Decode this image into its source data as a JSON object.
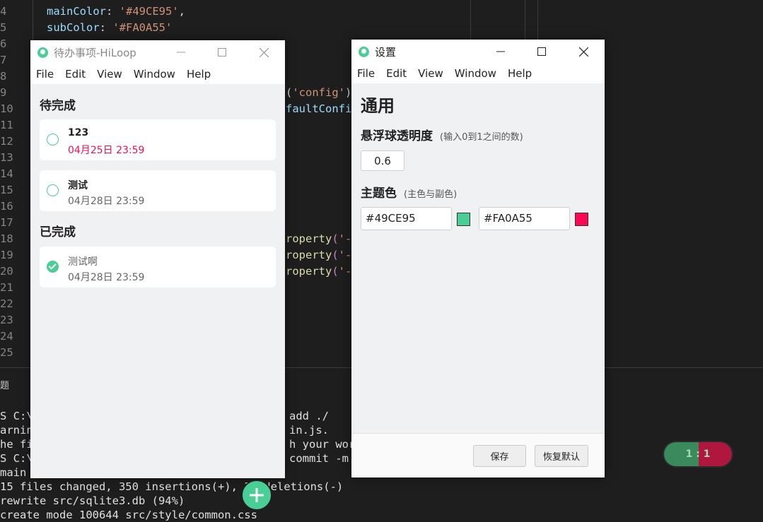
{
  "editor": {
    "lines": [
      {
        "num": "4",
        "parts": [
          [
            "kw",
            "mainColor"
          ],
          [
            "plain",
            ": "
          ],
          [
            "str",
            "'#49CE95'"
          ],
          [
            "plain",
            ","
          ]
        ]
      },
      {
        "num": "5",
        "parts": [
          [
            "kw",
            "subColor"
          ],
          [
            "plain",
            ": "
          ],
          [
            "str",
            "'#FA0A55'"
          ]
        ]
      },
      {
        "num": "6",
        "parts": []
      },
      {
        "num": "7",
        "parts": []
      },
      {
        "num": "8",
        "parts": []
      },
      {
        "num": "9",
        "parts": [
          [
            "plain",
            "("
          ],
          [
            "str",
            "'config'"
          ],
          [
            "plain",
            ")"
          ]
        ]
      },
      {
        "num": "10",
        "parts": [
          [
            "kw",
            "faultConfi"
          ]
        ]
      },
      {
        "num": "11",
        "parts": []
      },
      {
        "num": "12",
        "parts": []
      },
      {
        "num": "13",
        "parts": []
      },
      {
        "num": "14",
        "parts": []
      },
      {
        "num": "15",
        "parts": []
      },
      {
        "num": "16",
        "parts": []
      },
      {
        "num": "17",
        "parts": []
      },
      {
        "num": "18",
        "parts": [
          [
            "fn",
            "roperty"
          ],
          [
            "pn",
            "("
          ],
          [
            "str",
            "'-"
          ]
        ]
      },
      {
        "num": "19",
        "parts": [
          [
            "fn",
            "roperty"
          ],
          [
            "pn",
            "("
          ],
          [
            "str",
            "'-"
          ]
        ]
      },
      {
        "num": "20",
        "parts": [
          [
            "fn",
            "roperty"
          ],
          [
            "pn",
            "("
          ],
          [
            "str",
            "'-"
          ]
        ]
      },
      {
        "num": "21",
        "parts": []
      },
      {
        "num": "22",
        "parts": []
      },
      {
        "num": "23",
        "parts": []
      },
      {
        "num": "24",
        "parts": []
      },
      {
        "num": "25",
        "parts": []
      }
    ]
  },
  "terminal": {
    "title": "题",
    "lines": [
      "S C:\\",
      "arning",
      "he fi",
      "S C:\\",
      "main 8",
      "15 files changed, 350 insertions(+), 30 deletions(-)",
      "rewrite src/sqlite3.db (94%)",
      "create mode 100644 src/style/common.css"
    ],
    "right_fragments": [
      "add ./",
      "in.js.",
      "h your work",
      "commit -m"
    ]
  },
  "ratio_pill": {
    "label": "1 : 1"
  },
  "todo_window": {
    "title": "待办事项-HiLoop",
    "menu": [
      "File",
      "Edit",
      "View",
      "Window",
      "Help"
    ],
    "pending_heading": "待完成",
    "pending": [
      {
        "title": "123",
        "date": "04月25日 23:59",
        "overdue": true
      },
      {
        "title": "测试",
        "date": "04月28日 23:59",
        "overdue": false
      }
    ],
    "done_heading": "已完成",
    "done": [
      {
        "title": "测试啊",
        "date": "04月28日 23:59"
      }
    ],
    "add_icon": "plus-icon"
  },
  "settings_window": {
    "title": "设置",
    "menu": [
      "File",
      "Edit",
      "View",
      "Window",
      "Help"
    ],
    "heading": "通用",
    "opacity_label": "悬浮球透明度",
    "opacity_hint": "(输入0到1之间的数)",
    "opacity_value": "0.6",
    "theme_label": "主题色",
    "theme_hint": "(主色与副色)",
    "main_color": "#49CE95",
    "sub_color": "#FA0A55",
    "save_label": "保存",
    "reset_label": "恢复默认"
  },
  "icons": {
    "minimize": "minimize-icon",
    "maximize": "maximize-icon",
    "close": "close-icon",
    "app": "app-logo-icon"
  }
}
